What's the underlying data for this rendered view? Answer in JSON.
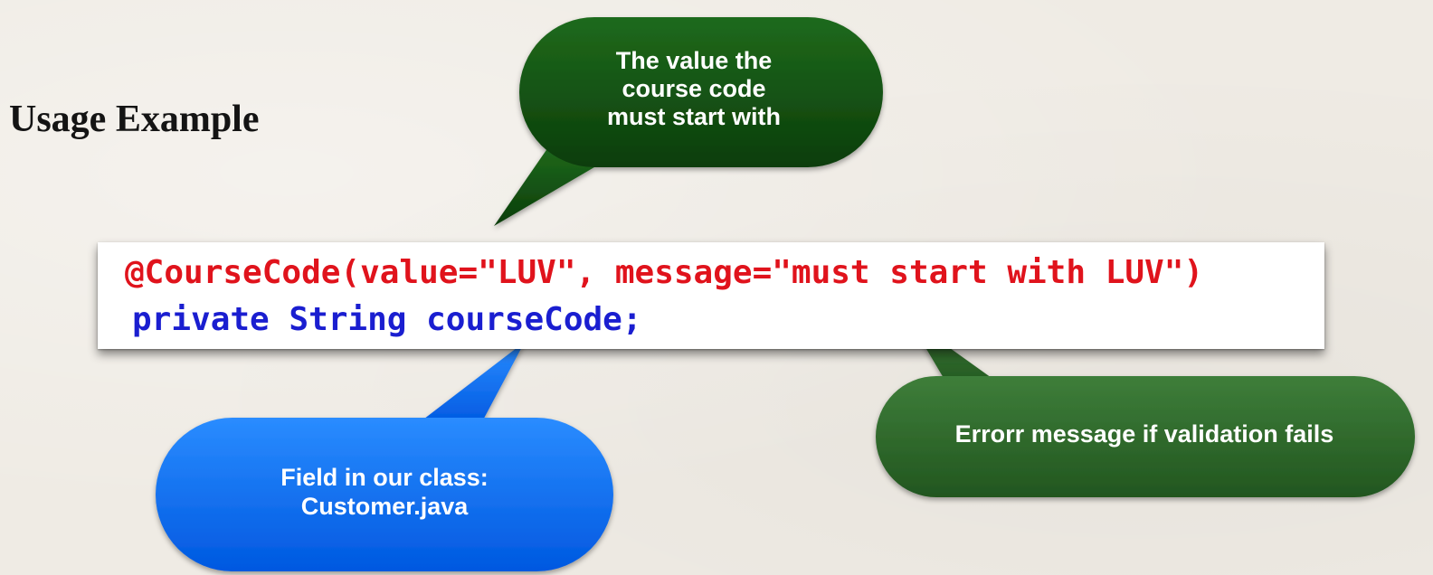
{
  "slide": {
    "title": "Usage Example"
  },
  "code": {
    "line1": "@CourseCode(value=\"LUV\", message=\"must start with LUV\")",
    "line2": "private String courseCode;"
  },
  "callouts": {
    "course_value": "The value the\ncourse code\nmust start with",
    "error_message": "Errorr message if validation fails",
    "field": "Field in our class:\nCustomer.java"
  },
  "colors": {
    "dark_green": "#0f4a0f",
    "mid_green": "#2d6a2a",
    "blue": "#0a6ef0",
    "annotation_red": "#e0131c",
    "keyword_blue": "#1a1ed0"
  }
}
